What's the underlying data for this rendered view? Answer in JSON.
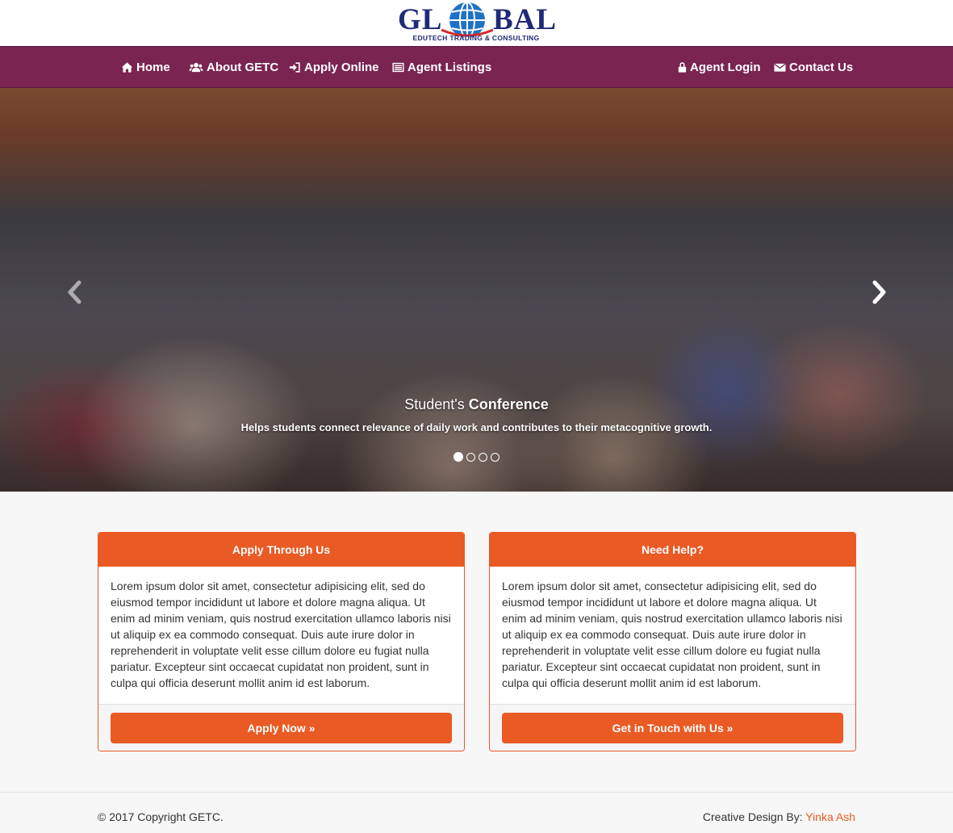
{
  "logo": {
    "left_text": "GL",
    "right_text": "BAL",
    "subtitle": "EDUTECH TRADING & CONSULTING"
  },
  "nav": {
    "home": "Home",
    "about": "About GETC",
    "apply": "Apply Online",
    "listings": "Agent Listings",
    "login": "Agent Login",
    "contact": "Contact Us"
  },
  "carousel": {
    "caption_title_prefix": "Student's ",
    "caption_title_bold": "Conference",
    "caption_text": "Helps students connect relevance of daily work and contributes to their metacognitive growth.",
    "slide_count": 4,
    "active_slide": 1
  },
  "panels": [
    {
      "heading": "Apply Through Us",
      "body": "Lorem ipsum dolor sit amet, consectetur adipisicing elit, sed do eiusmod tempor incididunt ut labore et dolore magna aliqua. Ut enim ad minim veniam, quis nostrud exercitation ullamco laboris nisi ut aliquip ex ea commodo consequat. Duis aute irure dolor in reprehenderit in voluptate velit esse cillum dolore eu fugiat nulla pariatur. Excepteur sint occaecat cupidatat non proident, sunt in culpa qui officia deserunt mollit anim id est laborum.",
      "button": "Apply Now »"
    },
    {
      "heading": "Need Help?",
      "body": "Lorem ipsum dolor sit amet, consectetur adipisicing elit, sed do eiusmod tempor incididunt ut labore et dolore magna aliqua. Ut enim ad minim veniam, quis nostrud exercitation ullamco laboris nisi ut aliquip ex ea commodo consequat. Duis aute irure dolor in reprehenderit in voluptate velit esse cillum dolore eu fugiat nulla pariatur. Excepteur sint occaecat cupidatat non proident, sunt in culpa qui officia deserunt mollit anim id est laborum.",
      "button": "Get in Touch with Us »"
    }
  ],
  "footer": {
    "copyright": "© 2017 Copyright GETC.",
    "credit_label": "Creative Design By: ",
    "credit_name": "Yinka Ash"
  },
  "colors": {
    "navbar": "#7a2452",
    "accent": "#e95a24",
    "logo_blue": "#1f2a78"
  },
  "icons": {
    "home": "home-icon",
    "about": "users-icon",
    "apply": "sign-in-icon",
    "listings": "list-icon",
    "login": "lock-icon",
    "contact": "envelope-icon",
    "prev": "chevron-left-icon",
    "next": "chevron-right-icon"
  }
}
